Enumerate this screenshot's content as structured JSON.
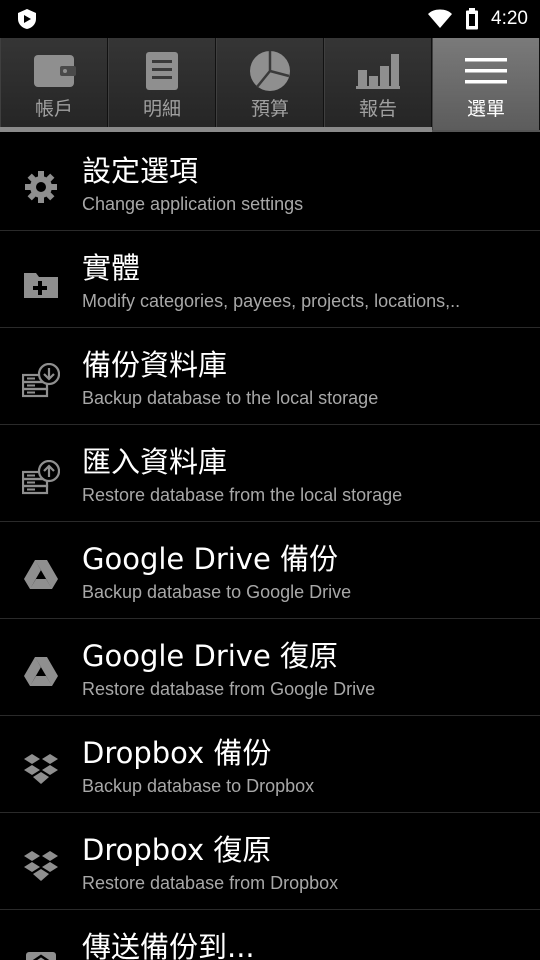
{
  "status_bar": {
    "time": "4:20",
    "icons": [
      "app-shield-icon",
      "wifi-icon",
      "battery-icon"
    ]
  },
  "tabs": [
    {
      "label": "帳戶",
      "icon": "wallet-icon",
      "active": false
    },
    {
      "label": "明細",
      "icon": "list-icon",
      "active": false
    },
    {
      "label": "預算",
      "icon": "pie-chart-icon",
      "active": false
    },
    {
      "label": "報告",
      "icon": "bar-chart-icon",
      "active": false
    },
    {
      "label": "選單",
      "icon": "menu-icon",
      "active": true
    }
  ],
  "menu": {
    "items": [
      {
        "title": "設定選項",
        "subtitle": "Change application settings",
        "icon": "gear-icon"
      },
      {
        "title": "實體",
        "subtitle": "Modify categories, payees, projects, locations,..",
        "icon": "folder-plus-icon"
      },
      {
        "title": "備份資料庫",
        "subtitle": "Backup database to the local storage",
        "icon": "database-backup-icon"
      },
      {
        "title": "匯入資料庫",
        "subtitle": "Restore database from the local storage",
        "icon": "database-restore-icon"
      },
      {
        "title": "Google Drive 備份",
        "subtitle": "Backup database to Google Drive",
        "icon": "google-drive-icon"
      },
      {
        "title": "Google Drive 復原",
        "subtitle": "Restore database from Google Drive",
        "icon": "google-drive-icon"
      },
      {
        "title": "Dropbox 備份",
        "subtitle": "Backup database to Dropbox",
        "icon": "dropbox-icon"
      },
      {
        "title": "Dropbox 復原",
        "subtitle": "Restore database from Dropbox",
        "icon": "dropbox-icon"
      },
      {
        "title": "傳送備份到...",
        "subtitle": "",
        "icon": "send-backup-icon"
      }
    ]
  },
  "colors": {
    "background": "#000000",
    "tab_active": "#6a6a6a",
    "tab_inactive": "#2e2e2e",
    "icon_grey": "#8f8f8f",
    "subtitle": "#a8a8a8",
    "divider": "#2a2a2a"
  }
}
